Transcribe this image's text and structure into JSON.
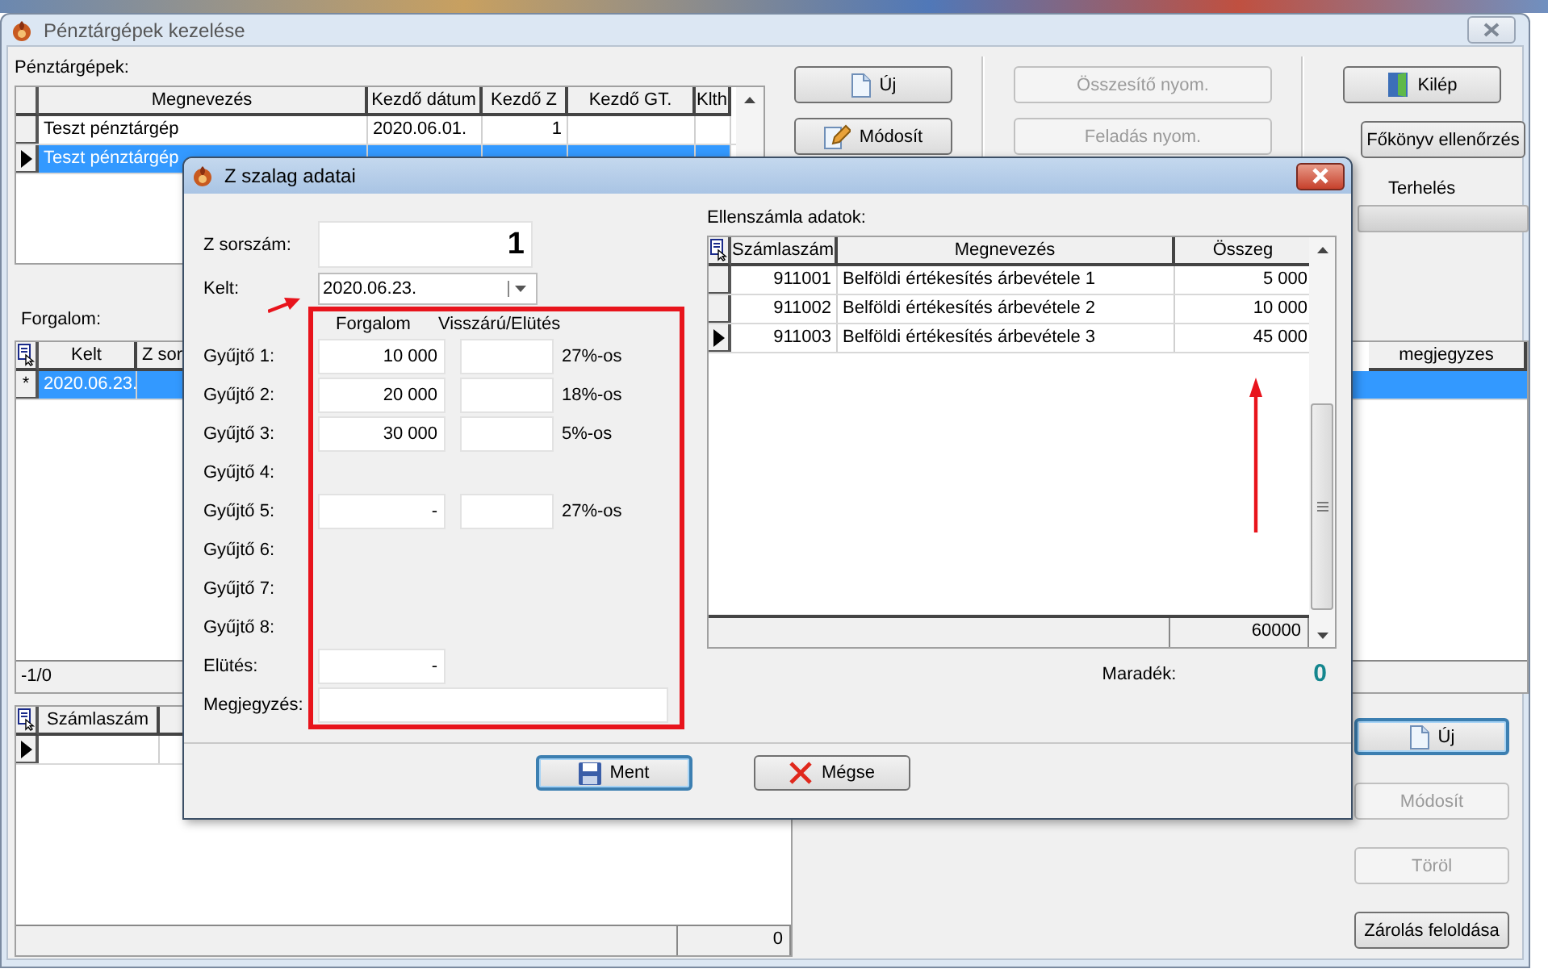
{
  "window": {
    "title": "Pénztárgépek kezelése"
  },
  "registers": {
    "label": "Pénztárgépek:",
    "columns": [
      "Megnevezés",
      "Kezdő dátum",
      "Kezdő Z",
      "Kezdő GT.",
      "Klth"
    ],
    "rows": [
      {
        "cells": [
          "Teszt pénztárgép",
          "2020.06.01.",
          "1"
        ],
        "selected": false
      },
      {
        "cells": [
          "Teszt pénztárgép"
        ],
        "selected": true
      }
    ]
  },
  "top_buttons": [
    {
      "label": "Új",
      "disabled": false
    },
    {
      "label": "Összesítő nyom.",
      "disabled": true
    },
    {
      "label": "Kilép",
      "disabled": false
    },
    {
      "label": "Módosít",
      "disabled": false
    },
    {
      "label": "Feladás nyom.",
      "disabled": true
    },
    {
      "label": "Főkönyv ellenőrzés",
      "disabled": false
    }
  ],
  "debit": {
    "label": "Terhelés"
  },
  "turnover": {
    "label": "Forgalom:",
    "columns": [
      "Kelt",
      "Z sor",
      "megjegyzes"
    ],
    "rows": [
      {
        "marker": "*",
        "cells": [
          "2020.06.23."
        ],
        "selected": true
      }
    ],
    "status": "-1/0"
  },
  "invoices": {
    "columns": [
      "Számlaszám"
    ],
    "total": "0"
  },
  "side_buttons": [
    {
      "label": "Új",
      "disabled": false,
      "focused": true
    },
    {
      "label": "Módosít",
      "disabled": true,
      "focused": false
    },
    {
      "label": "Töröl",
      "disabled": true,
      "focused": false
    },
    {
      "label": "Zárolás feloldása",
      "disabled": false,
      "focused": false
    }
  ],
  "dialog": {
    "title": "Z szalag adatai",
    "z_number": {
      "label": "Z sorszám:",
      "value": "1"
    },
    "date": {
      "label": "Kelt:",
      "value": "2020.06.23."
    },
    "headers": [
      "Forgalom",
      "Visszárú/Elütés"
    ],
    "collectors": [
      {
        "label": "Gyűjtő 1:",
        "kind": "input",
        "turnover": "10 000",
        "rate": "27%-os"
      },
      {
        "label": "Gyűjtő 2:",
        "kind": "input",
        "turnover": "20 000",
        "rate": "18%-os"
      },
      {
        "label": "Gyűjtő 3:",
        "kind": "input",
        "turnover": "30 000",
        "rate": "5%-os"
      },
      {
        "label": "Gyűjtő 4:",
        "kind": "label"
      },
      {
        "label": "Gyűjtő 5:",
        "kind": "input",
        "turnover": "-",
        "rate": "27%-os"
      },
      {
        "label": "Gyűjtő 6:",
        "kind": "label"
      },
      {
        "label": "Gyűjtő 7:",
        "kind": "label"
      },
      {
        "label": "Gyűjtő 8:",
        "kind": "label"
      }
    ],
    "deduction": {
      "label": "Elütés:",
      "value": "-"
    },
    "note": {
      "label": "Megjegyzés:"
    },
    "counter": {
      "label": "Ellenszámla adatok:",
      "columns": [
        "Számlaszám",
        "Megnevezés",
        "Összeg"
      ],
      "rows": [
        {
          "number": "911001",
          "name": "Belföldi értékesítés árbevétele 1",
          "amount": "5 000",
          "selected": false
        },
        {
          "number": "911002",
          "name": "Belföldi értékesítés árbevétele 2",
          "amount": "10 000",
          "selected": false
        },
        {
          "number": "911003",
          "name": "Belföldi értékesítés árbevétele 3",
          "amount": "45 000",
          "selected": true
        }
      ],
      "total": "60000"
    },
    "remainder": {
      "label": "Maradék:",
      "value": "0"
    },
    "buttons": [
      {
        "label": "Ment",
        "focused": true
      },
      {
        "label": "Mégse",
        "focused": false
      }
    ]
  }
}
